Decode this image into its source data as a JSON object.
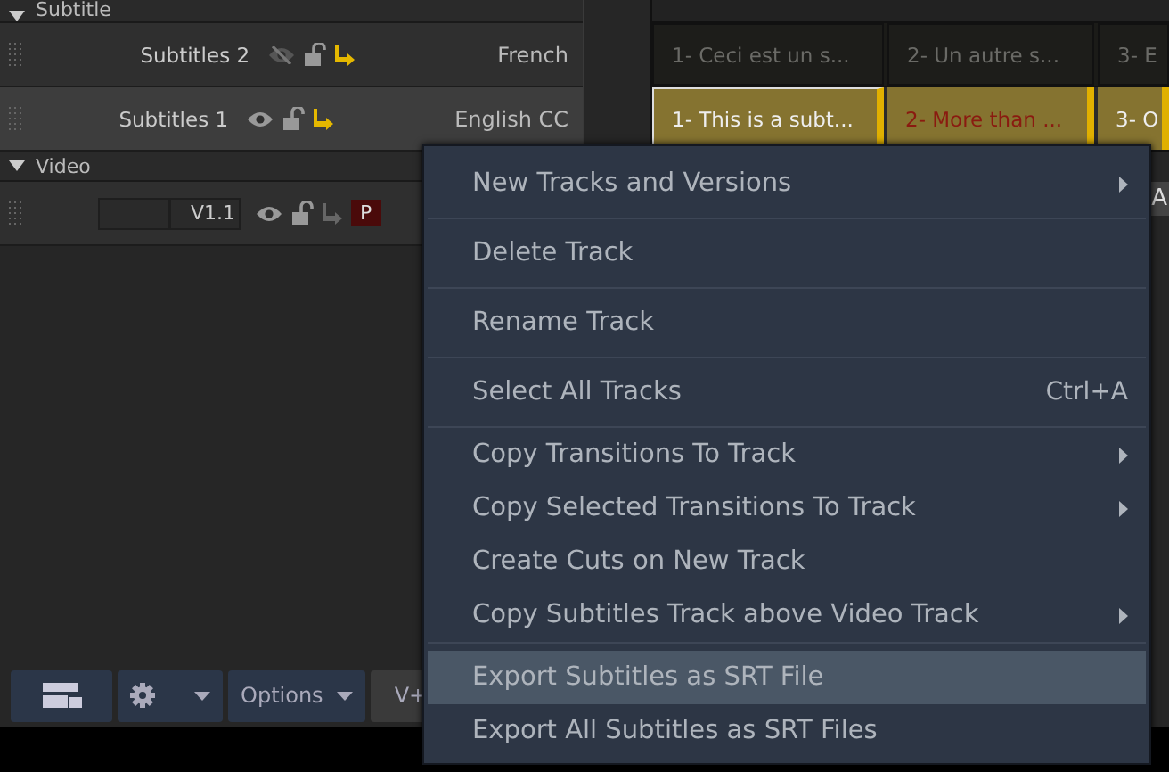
{
  "groups": [
    {
      "name": "Subtitle",
      "expanded": true
    },
    {
      "name": "Video",
      "expanded": true
    }
  ],
  "subtitle_tracks": [
    {
      "name": "Subtitles 2",
      "visible": false,
      "sync": true,
      "language": "French",
      "selected": false,
      "clips": [
        {
          "text": "1- Ceci est un s...",
          "selected": false
        },
        {
          "text": "2- Un autre s...",
          "selected": false
        },
        {
          "text": "3- E",
          "selected": false
        }
      ]
    },
    {
      "name": "Subtitles 1",
      "visible": true,
      "sync": true,
      "language": "English CC",
      "selected": true,
      "clips": [
        {
          "text": "1- This is a subt...",
          "selected": true,
          "error": false
        },
        {
          "text": "2- More than ...",
          "selected": false,
          "error": true
        },
        {
          "text": "3- O",
          "selected": false,
          "error": false
        }
      ]
    }
  ],
  "video_track": {
    "name": "V1.1",
    "visible": true,
    "sync": false,
    "badge": "P"
  },
  "toolbar": {
    "options_label": "Options",
    "add_label": "V+"
  },
  "edge_texts": [
    "A"
  ],
  "menu": {
    "sections": [
      [
        {
          "label": "New Tracks and Versions",
          "submenu": true,
          "selected": false
        }
      ],
      [
        {
          "label": "Delete Track",
          "submenu": false,
          "selected": false
        }
      ],
      [
        {
          "label": "Rename Track",
          "submenu": false,
          "selected": false
        }
      ],
      [
        {
          "label": "Select All Tracks",
          "shortcut": "Ctrl+A",
          "submenu": false,
          "selected": false
        }
      ],
      [
        {
          "label": "Copy Transitions To Track",
          "submenu": true,
          "selected": false
        },
        {
          "label": "Copy Selected Transitions To Track",
          "submenu": true,
          "selected": false
        },
        {
          "label": "Create Cuts on New Track",
          "submenu": false,
          "selected": false
        },
        {
          "label": "Copy Subtitles Track above Video Track",
          "submenu": true,
          "selected": false
        }
      ],
      [
        {
          "label": "Export Subtitles as SRT File",
          "submenu": false,
          "selected": true
        },
        {
          "label": "Export All Subtitles as SRT Files",
          "submenu": false,
          "selected": false
        }
      ]
    ]
  }
}
